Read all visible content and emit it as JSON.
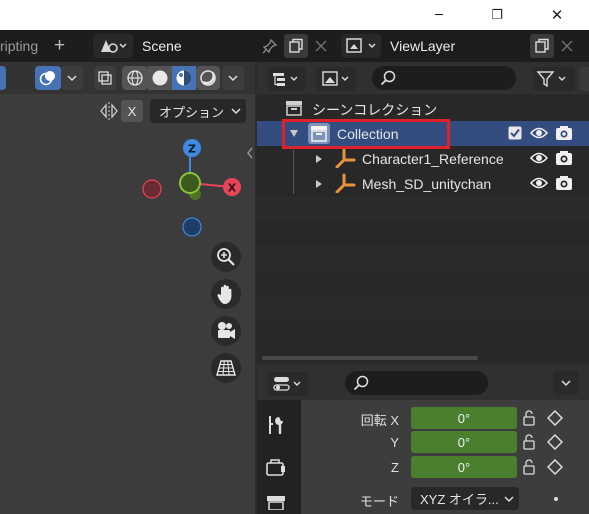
{
  "window": {
    "minimize_glyph": "─",
    "maximize_glyph": "❐",
    "close_glyph": "✕"
  },
  "topbar": {
    "workspace_tab_partial": "ripting",
    "add_tab_glyph": "+",
    "scene_label": "Scene",
    "viewlayer_label": "ViewLayer"
  },
  "viewport": {
    "options_label": "オプション",
    "x_label": "X",
    "gizmo": {
      "z": "Z",
      "x": "X"
    }
  },
  "outliner": {
    "scene_collection": "シーンコレクション",
    "items": [
      {
        "label": "Collection",
        "selected": true
      },
      {
        "label": "Character1_Reference"
      },
      {
        "label": "Mesh_SD_unitychan"
      }
    ]
  },
  "properties": {
    "rotation_label": "回転 X",
    "rows": [
      {
        "label": "回転 X",
        "value": "0°"
      },
      {
        "label": "Y",
        "value": "0°"
      },
      {
        "label": "Z",
        "value": "0°"
      }
    ],
    "mode_label": "モード",
    "mode_value": "XYZ オイラ..."
  },
  "colors": {
    "accent": "#4772b3",
    "selection_row": "#334d80",
    "highlight_box": "#e0202a",
    "green_field": "#4a7f2e",
    "axis_x": "#e8455a",
    "axis_y": "#8ac33a",
    "axis_z": "#3e8ae0"
  }
}
